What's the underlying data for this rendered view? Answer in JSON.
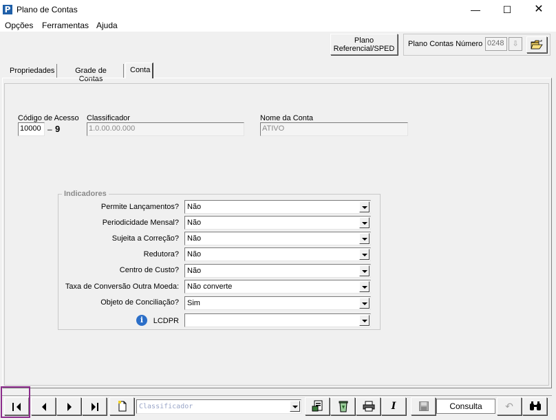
{
  "window": {
    "title": "Plano de Contas",
    "icon_letter": "P",
    "minimize_glyph": "—",
    "maximize_glyph": "☐",
    "close_glyph": "✕"
  },
  "menu": [
    "Opções",
    "Ferramentas",
    "Ajuda"
  ],
  "toolbar": {
    "plano_ref_line1": "Plano",
    "plano_ref_line2": "Referencial/SPED",
    "plano_contas_label": "Plano Contas Número",
    "plano_contas_value": "0248"
  },
  "tabs": [
    {
      "label": "Propriedades",
      "active": false
    },
    {
      "label": "Grade de Contas",
      "active": false
    },
    {
      "label": "Conta",
      "active": true
    }
  ],
  "form": {
    "codigo_label": "Código de Acesso",
    "codigo_value": "10000",
    "codigo_sep": "–",
    "codigo_digit": "9",
    "classificador_label": "Classificador",
    "classificador_value": "1.0.00.00.000",
    "nome_label": "Nome da Conta",
    "nome_value": "ATIVO"
  },
  "indicadores": {
    "title": "Indicadores",
    "rows": [
      {
        "label": "Permite Lançamentos?",
        "value": "Não"
      },
      {
        "label": "Periodicidade Mensal?",
        "value": "Não"
      },
      {
        "label": "Sujeita a Correção?",
        "value": "Não"
      },
      {
        "label": "Redutora?",
        "value": "Não"
      },
      {
        "label": "Centro de Custo?",
        "value": "Não"
      },
      {
        "label": "Taxa de Conversão Outra Moeda:",
        "value": "Não converte"
      },
      {
        "label": "Objeto de Conciliação?",
        "value": "Sim"
      },
      {
        "label": "LCDPR",
        "value": ""
      }
    ]
  },
  "bottombar": {
    "search_placeholder": "Classificador",
    "mode_label": "Consulta",
    "icons": [
      "first-record-icon",
      "previous-record-icon",
      "next-record-icon",
      "last-record-icon",
      "new-document-icon",
      "report-icon",
      "recycle-icon",
      "print-icon",
      "italic-icon",
      "save-icon",
      "undo-icon",
      "binoculars-icon"
    ]
  },
  "colors": {
    "app_icon": "#1f5fa8",
    "info_icon": "#2c6fc8",
    "highlight": "#8b2a8b",
    "placeholder": "#9aa6c8"
  }
}
